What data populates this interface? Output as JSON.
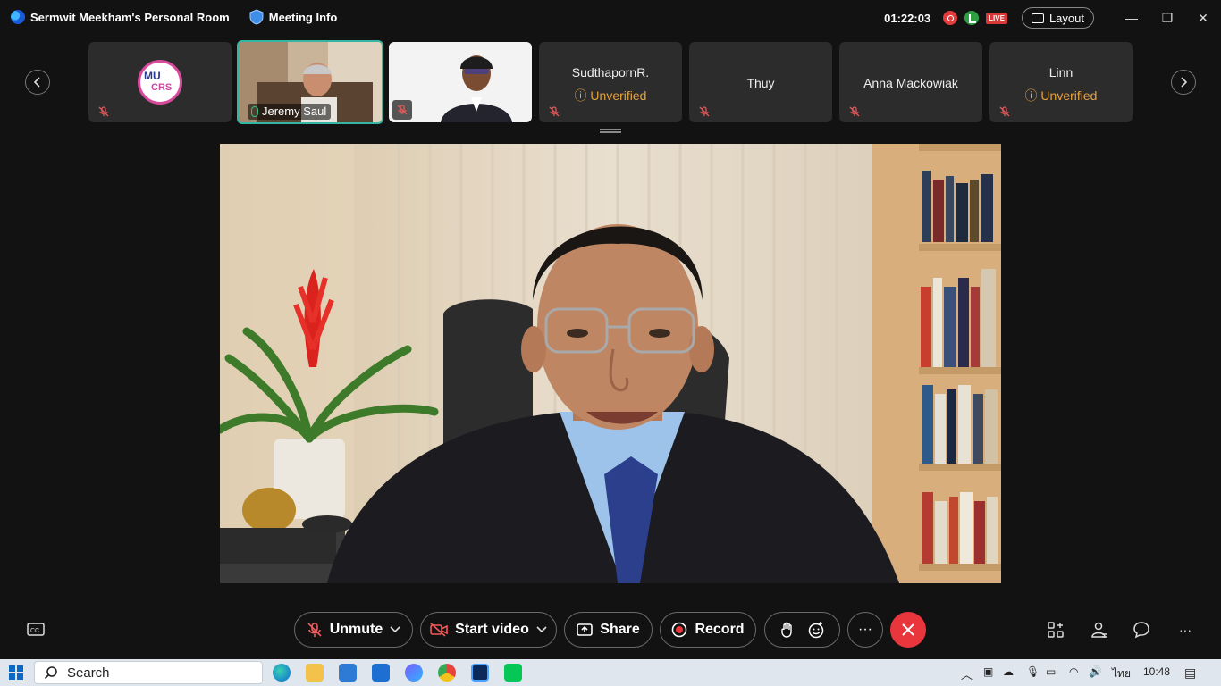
{
  "titlebar": {
    "room_name": "Sermwit Meekham's Personal Room",
    "meeting_info": "Meeting Info",
    "timer": "01:22:03",
    "live_badge": "LIVE",
    "layout_label": "Layout"
  },
  "participants": [
    {
      "name": "",
      "logo_line1": "MU",
      "logo_line2": "CRS",
      "muted": true
    },
    {
      "name": "Jeremy Saul",
      "muted": false,
      "active": true
    },
    {
      "name": "",
      "muted": true
    },
    {
      "name": "SudthapornR.",
      "status": "Unverified",
      "muted": true
    },
    {
      "name": "Thuy",
      "muted": true
    },
    {
      "name": "Anna Mackowiak",
      "muted": true
    },
    {
      "name": "Linn",
      "status": "Unverified",
      "muted": true
    }
  ],
  "controls": {
    "unmute": "Unmute",
    "start_video": "Start video",
    "share": "Share",
    "record": "Record",
    "more": "···"
  },
  "taskbar": {
    "search": "Search",
    "lang": "ไทย",
    "time": "10:48"
  },
  "colors": {
    "accent_active": "#35b6a3",
    "unverified": "#e8a33d",
    "end_call": "#e8363c"
  }
}
